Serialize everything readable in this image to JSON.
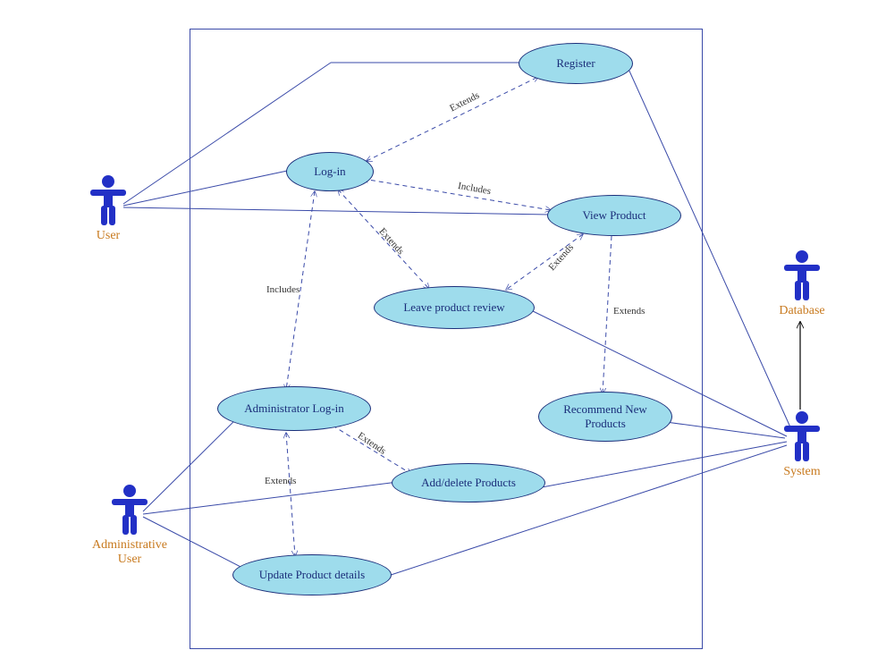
{
  "actors": {
    "user": {
      "label": "User"
    },
    "admin": {
      "label": "Administrative User"
    },
    "system": {
      "label": "System"
    },
    "database": {
      "label": "Database"
    }
  },
  "usecases": {
    "register": {
      "label": "Register"
    },
    "login": {
      "label": "Log-in"
    },
    "viewProduct": {
      "label": "View Product"
    },
    "leaveReview": {
      "label": "Leave product review"
    },
    "adminLogin": {
      "label": "Administrator Log-in"
    },
    "recommend": {
      "label": "Recommend New Products"
    },
    "addDelete": {
      "label": "Add/delete Products"
    },
    "updateDetails": {
      "label": "Update Product details"
    }
  },
  "relations": {
    "r1": {
      "label": "Extends"
    },
    "r2": {
      "label": "Includes"
    },
    "r3": {
      "label": "Extends"
    },
    "r4": {
      "label": "Extends"
    },
    "r5": {
      "label": "Extends"
    },
    "r6": {
      "label": "Includes"
    },
    "r7": {
      "label": "Extends"
    },
    "r8": {
      "label": "Extends"
    }
  }
}
